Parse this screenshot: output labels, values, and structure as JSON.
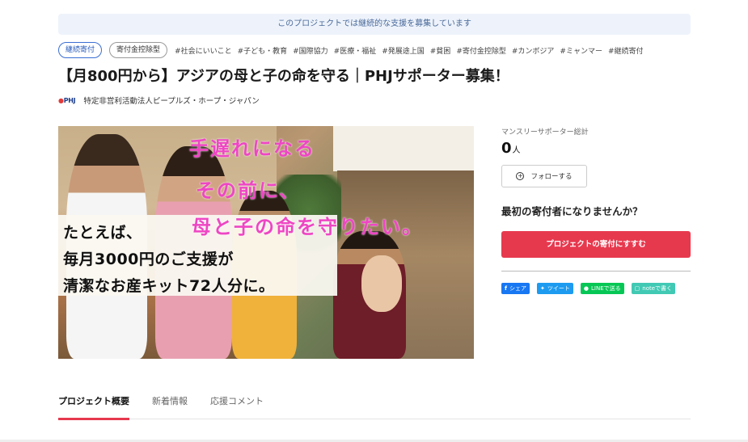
{
  "banner": {
    "text": "このプロジェクトでは継続的な支援を募集しています"
  },
  "pills": [
    {
      "label": "継続寄付",
      "style": "blue"
    },
    {
      "label": "寄付金控除型",
      "style": "gray"
    }
  ],
  "hashtags": [
    "#社会にいいこと",
    "#子ども・教育",
    "#国際協力",
    "#医療・福祉",
    "#発展途上国",
    "#貧困",
    "#寄付金控除型",
    "#カンボジア",
    "#ミャンマー",
    "#継続寄付"
  ],
  "title": "【月800円から】アジアの母と子の命を守る｜PHJサポーター募集！",
  "org": {
    "logo": "PHJ",
    "name": "特定非営利活動法人ピープルズ・ホープ・ジャパン"
  },
  "hero": {
    "pink_lines": [
      "手遅れになる",
      "その前に、",
      "母と子の命を守りたい。"
    ],
    "caption_lines": [
      "たとえば、",
      "毎月3000円のご支援が",
      "清潔なお産キット72人分に。"
    ]
  },
  "side": {
    "stat_label": "マンスリーサポーター総計",
    "stat_value": "0",
    "stat_unit": "人",
    "follow_label": "フォローする",
    "first_donor": "最初の寄付者になりませんか？",
    "donate_label": "プロジェクトの寄付にすすむ",
    "share": {
      "facebook": "シェア",
      "twitter": "ツイート",
      "line": "LINEで送る",
      "note": "noteで書く"
    }
  },
  "tabs": [
    {
      "label": "プロジェクト概要",
      "active": true
    },
    {
      "label": "新着情報",
      "active": false
    },
    {
      "label": "応援コメント",
      "active": false
    }
  ],
  "colors": {
    "accent": "#e7394e",
    "pink": "#ee46c4",
    "blue_pill": "#3b6fd4"
  }
}
